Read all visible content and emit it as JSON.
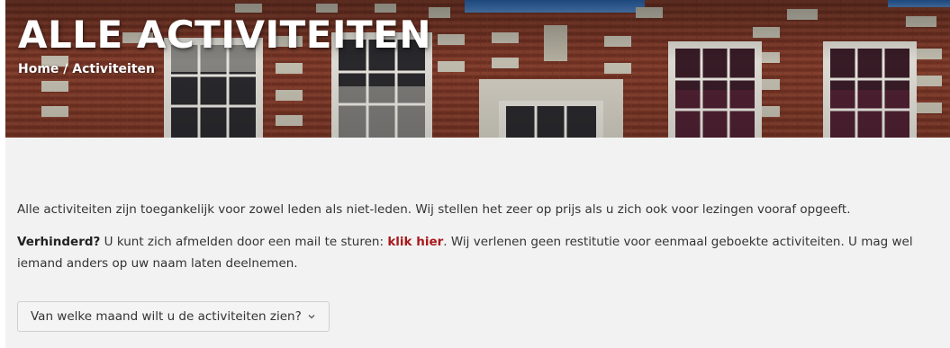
{
  "hero": {
    "title": "ALLE ACTIVITEITEN",
    "breadcrumb": {
      "home": "Home",
      "separator": " / ",
      "current": "Activiteiten"
    }
  },
  "intro": {
    "text": "Alle activiteiten zijn toegankelijk voor zowel leden als niet-leden. Wij stellen het zeer op prijs als u zich ook voor lezingen vooraf opgeeft."
  },
  "cancel": {
    "label": "Verhinderd?",
    "text_before": " U kunt zich afmelden door een mail te sturen: ",
    "link": "klik hier",
    "text_after": ". Wij verlenen geen restitutie voor eenmaal geboekte activiteiten. U mag wel iemand anders op uw naam laten deelnemen."
  },
  "month_filter": {
    "label": "Van welke maand wilt u de activiteiten zien?",
    "icon": "chevron-down-icon"
  },
  "colors": {
    "link": "#a8191c",
    "content_bg": "#f2f2f2",
    "text": "#333333"
  }
}
